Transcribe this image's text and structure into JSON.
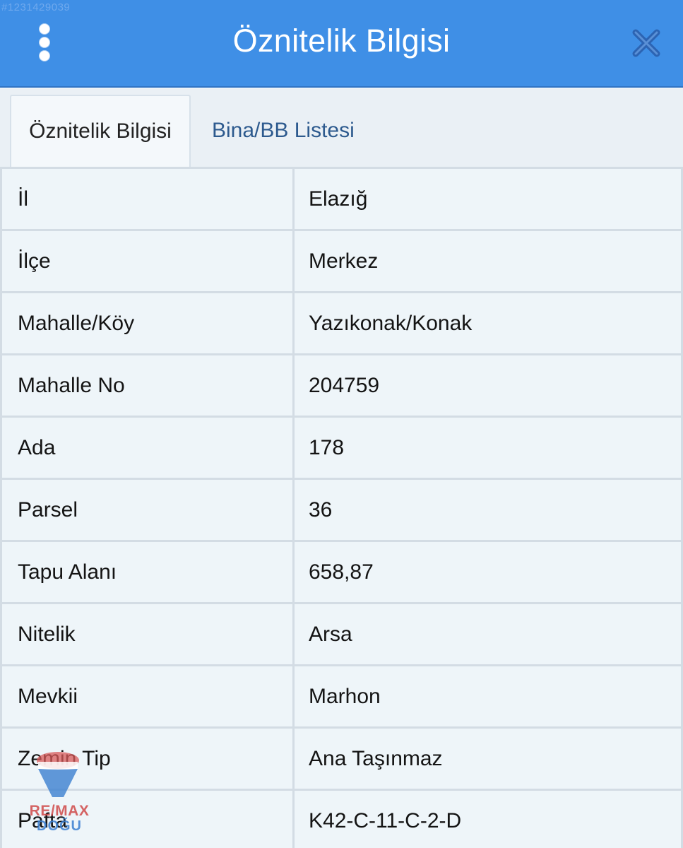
{
  "listing_id": "#1231429039",
  "header": {
    "title": "Öznitelik Bilgisi",
    "menu_icon": "vertical-dots-icon",
    "close_icon": "close-icon"
  },
  "tabs": [
    {
      "label": "Öznitelik Bilgisi",
      "active": true
    },
    {
      "label": "Bina/BB Listesi",
      "active": false
    }
  ],
  "rows": [
    {
      "label": "İl",
      "value": "Elazığ"
    },
    {
      "label": "İlçe",
      "value": "Merkez"
    },
    {
      "label": "Mahalle/Köy",
      "value": "Yazıkonak/Konak"
    },
    {
      "label": "Mahalle No",
      "value": "204759"
    },
    {
      "label": "Ada",
      "value": "178"
    },
    {
      "label": "Parsel",
      "value": "36"
    },
    {
      "label": "Tapu Alanı",
      "value": "658,87"
    },
    {
      "label": "Nitelik",
      "value": "Arsa"
    },
    {
      "label": "Mevkii",
      "value": "Marhon"
    },
    {
      "label": "Zemin Tip",
      "value": "Ana Taşınmaz"
    },
    {
      "label": "Pafta",
      "value": "K42-C-11-C-2-D"
    }
  ],
  "watermark": {
    "brand": "RE/MAX",
    "sub": "DOĞU"
  },
  "colors": {
    "header_bg": "#3f8fe6",
    "tab_inactive_text": "#2d5a8e",
    "cell_bg": "#eef5f9",
    "grid_line": "#d3dce4"
  }
}
